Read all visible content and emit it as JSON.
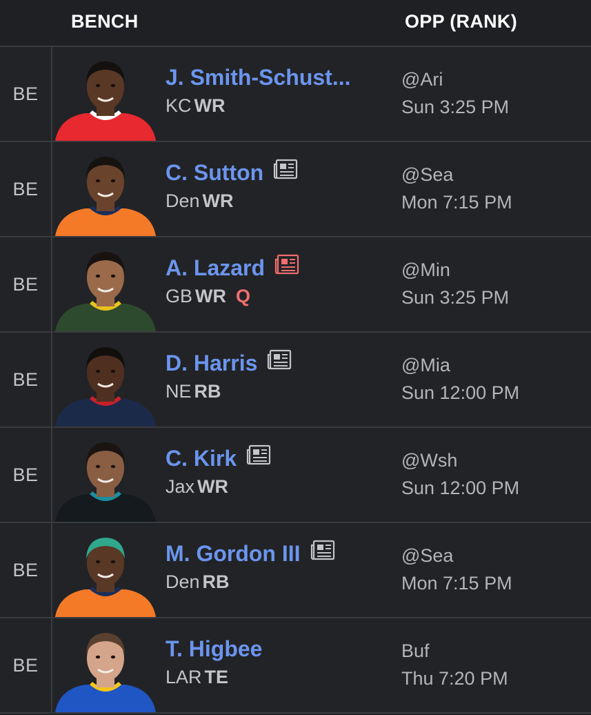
{
  "header": {
    "bench_label": "BENCH",
    "opp_label": "OPP (RANK)"
  },
  "colors": {
    "background": "#1f2023",
    "row_background": "#222326",
    "divider": "#3a3b3f",
    "player_name": "#6b95ee",
    "status_red": "#f26e6e",
    "secondary_text": "#c4c5c8"
  },
  "players": [
    {
      "slot": "BE",
      "name": "J. Smith-Schust...",
      "team": "KC",
      "position": "WR",
      "status": "",
      "news_icon": "none",
      "opponent": "@Ari",
      "game_time": "Sun 3:25 PM",
      "jersey_color": "#e8292f",
      "collar_color": "#ffffff",
      "skin_color": "#5a3826",
      "hair_color": "#141010"
    },
    {
      "slot": "BE",
      "name": "C. Sutton",
      "team": "Den",
      "position": "WR",
      "status": "",
      "news_icon": "newspaper-icon",
      "opponent": "@Sea",
      "game_time": "Mon 7:15 PM",
      "jersey_color": "#f47a28",
      "collar_color": "#1a2f5a",
      "skin_color": "#6a432c",
      "hair_color": "#161210"
    },
    {
      "slot": "BE",
      "name": "A. Lazard",
      "team": "GB",
      "position": "WR",
      "status": "Q",
      "news_icon": "newspaper-icon-alert",
      "opponent": "@Min",
      "game_time": "Sun 3:25 PM",
      "jersey_color": "#2e4a2e",
      "collar_color": "#e8c21c",
      "skin_color": "#9a6a4a",
      "hair_color": "#1a1210"
    },
    {
      "slot": "BE",
      "name": "D. Harris",
      "team": "NE",
      "position": "RB",
      "status": "",
      "news_icon": "newspaper-icon",
      "opponent": "@Mia",
      "game_time": "Sun 12:00 PM",
      "jersey_color": "#1c2a4a",
      "collar_color": "#c8202a",
      "skin_color": "#4e2f20",
      "hair_color": "#120e0c"
    },
    {
      "slot": "BE",
      "name": "C. Kirk",
      "team": "Jax",
      "position": "WR",
      "status": "",
      "news_icon": "newspaper-icon",
      "opponent": "@Wsh",
      "game_time": "Sun 12:00 PM",
      "jersey_color": "#141a1e",
      "collar_color": "#1a8ea0",
      "skin_color": "#8a5e42",
      "hair_color": "#1a1412"
    },
    {
      "slot": "BE",
      "name": "M. Gordon III",
      "team": "Den",
      "position": "RB",
      "status": "",
      "news_icon": "newspaper-icon",
      "opponent": "@Sea",
      "game_time": "Mon 7:15 PM",
      "jersey_color": "#f47a28",
      "collar_color": "#1a2f5a",
      "skin_color": "#5a3826",
      "hair_color": "#2fa88c"
    },
    {
      "slot": "BE",
      "name": "T. Higbee",
      "team": "LAR",
      "position": "TE",
      "status": "",
      "news_icon": "none",
      "opponent": "Buf",
      "game_time": "Thu 7:20 PM",
      "jersey_color": "#1f56c4",
      "collar_color": "#f5c518",
      "skin_color": "#d4a58a",
      "hair_color": "#5a4030"
    }
  ]
}
